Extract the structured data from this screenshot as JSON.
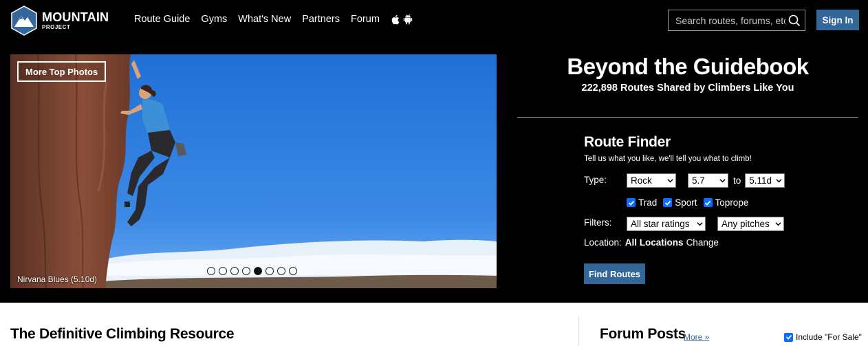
{
  "header": {
    "logo_main": "MOUNTAIN",
    "logo_sub": "PROJECT",
    "nav": [
      "Route Guide",
      "Gyms",
      "What's New",
      "Partners",
      "Forum"
    ],
    "app_icons": [
      "apple-icon",
      "android-icon"
    ],
    "search_placeholder": "Search routes, forums, etc",
    "sign_in": "Sign In"
  },
  "hero": {
    "more_photos": "More Top Photos",
    "caption": "Nirvana Blues (5.10d)",
    "slide_count": 8,
    "active_slide": 5
  },
  "tagline": {
    "title": "Beyond the Guidebook",
    "subtitle": "222,898 Routes Shared by Climbers Like You"
  },
  "route_finder": {
    "title": "Route Finder",
    "intro": "Tell us what you like, we'll tell you what to climb!",
    "type_label": "Type:",
    "type_value": "Rock",
    "grade_from": "5.7",
    "to_label": "to",
    "grade_to": "5.11d",
    "checkboxes": [
      {
        "label": "Trad",
        "checked": true
      },
      {
        "label": "Sport",
        "checked": true
      },
      {
        "label": "Toprope",
        "checked": true
      }
    ],
    "filters_label": "Filters:",
    "stars_value": "All star ratings",
    "pitches_value": "Any pitches",
    "location_label": "Location:",
    "location_value": "All Locations",
    "location_change": "Change",
    "find_button": "Find Routes"
  },
  "lower": {
    "heading": "The Definitive Climbing Resource",
    "forum_heading": "Forum Posts",
    "forum_more": "More »",
    "include_sale": "Include \"For Sale\"",
    "include_sale_checked": true
  },
  "colors": {
    "accent": "#336699",
    "background": "#000000",
    "checkbox": "#0d6efd"
  }
}
